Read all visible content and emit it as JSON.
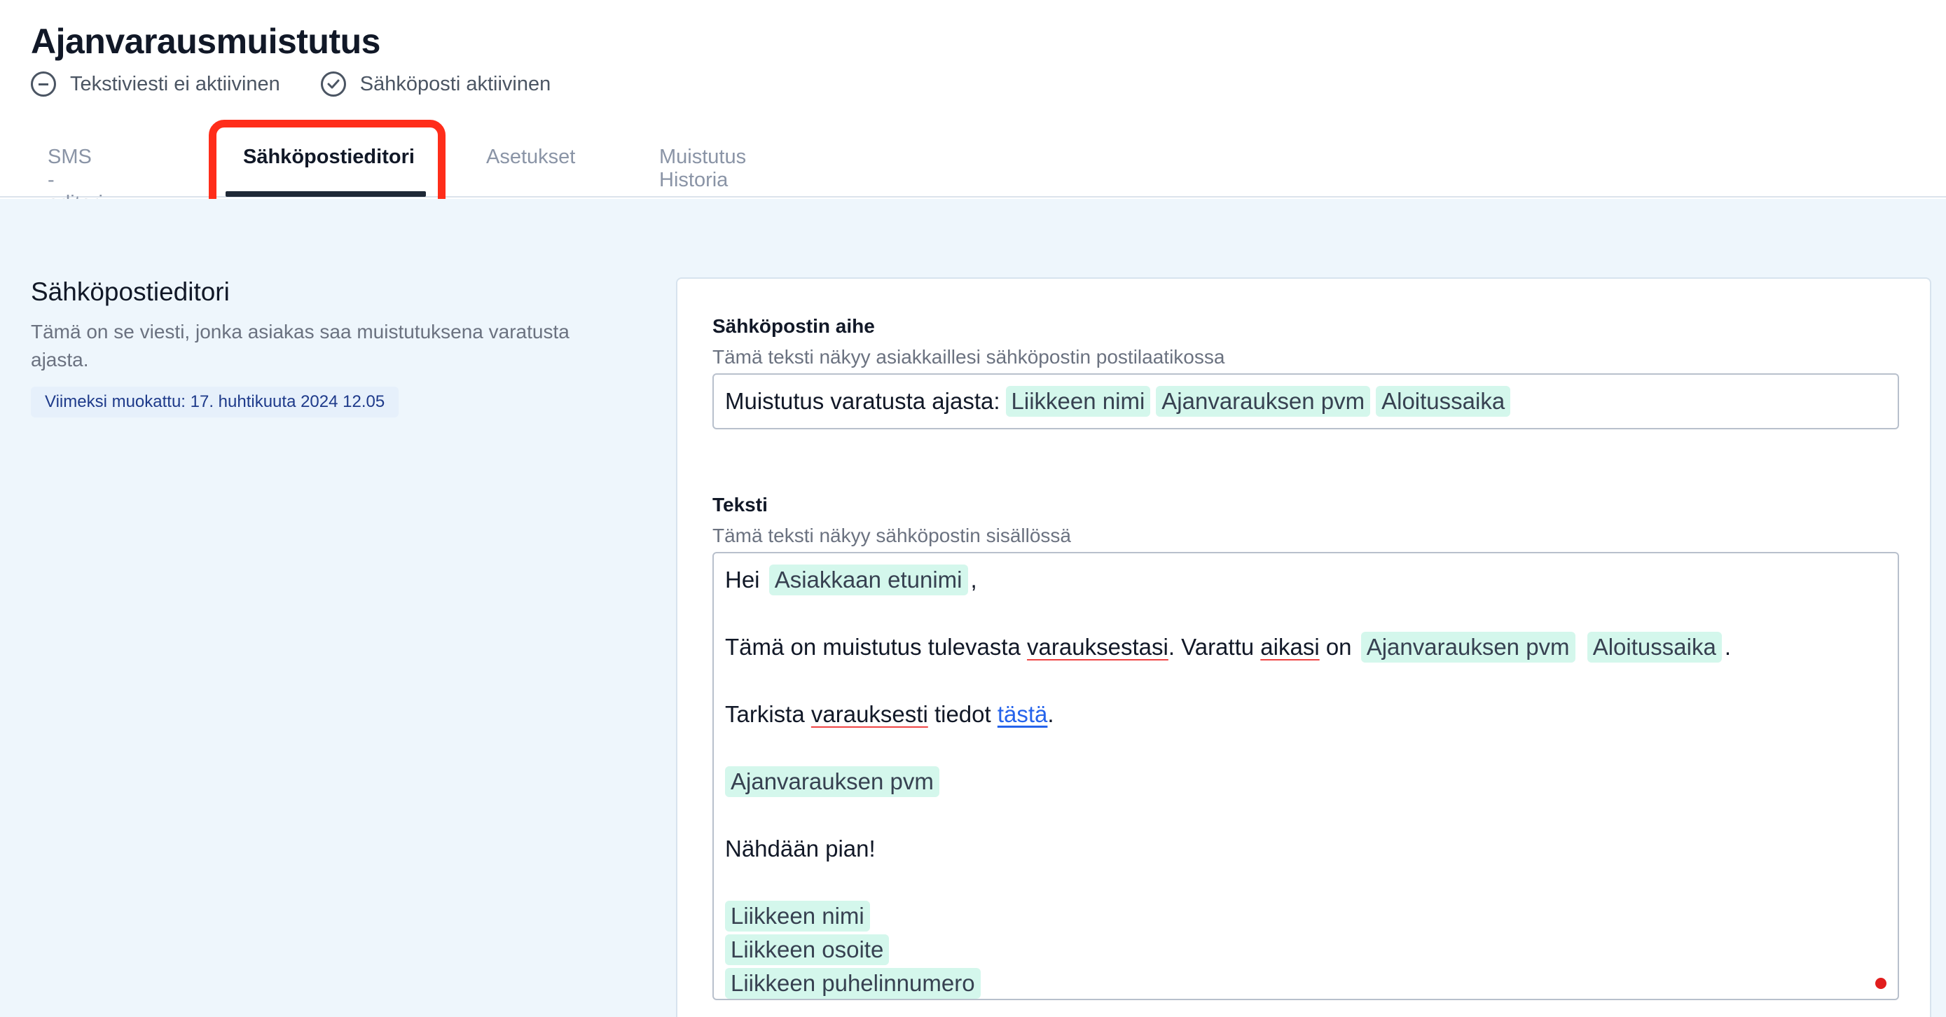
{
  "page": {
    "title": "Ajanvarausmuistutus",
    "statuses": [
      {
        "label": "Tekstiviesti ei aktiivinen",
        "icon": "minus-circle-icon"
      },
      {
        "label": "Sähköposti aktiivinen",
        "icon": "check-circle-icon"
      }
    ]
  },
  "tabs": [
    {
      "label": "SMS -editori",
      "active": false
    },
    {
      "label": "Sähköpostieditori",
      "active": true
    },
    {
      "label": "Asetukset",
      "active": false
    },
    {
      "label": "Muistutus Historia",
      "active": false
    }
  ],
  "left_panel": {
    "title": "Sähköpostieditori",
    "description": "Tämä on se viesti, jonka asiakas saa muistutuksena varatusta ajasta.",
    "last_modified": "Viimeksi muokattu: 17. huhtikuuta 2024 12.05"
  },
  "subject": {
    "label": "Sähköpostin aihe",
    "help": "Tämä teksti näkyy asiakkaillesi sähköpostin postilaatikossa",
    "prefix": "Muistutus varatusta ajasta:",
    "tags": [
      "Liikkeen nimi",
      "Ajanvarauksen pvm",
      "Aloitussaika"
    ]
  },
  "body": {
    "label": "Teksti",
    "help": "Tämä teksti näkyy sähköpostin sisällössä",
    "greeting_prefix": "Hei",
    "greeting_tag": "Asiakkaan etunimi",
    "greeting_suffix": ",",
    "line2_text1": "Tämä on muistutus tulevasta",
    "line2_word1": "varauksestasi",
    "line2_text2": ". Varattu",
    "line2_word2": "aikasi",
    "line2_text3": "on",
    "line2_tag1": "Ajanvarauksen pvm",
    "line2_tag2": "Aloitussaika",
    "line2_end": ".",
    "line3_text1": "Tarkista",
    "line3_word1": "varauksesti",
    "line3_text2": "tiedot",
    "line3_link": "tästä",
    "line3_end": ".",
    "date_tag": "Ajanvarauksen pvm",
    "closing": "Nähdään pian!",
    "signature_tags": [
      "Liikkeen nimi",
      "Liikkeen osoite",
      "Liikkeen puhelinnumero"
    ]
  },
  "colors": {
    "tag_bg": "#d4f7ec",
    "highlight": "#ff2d1a",
    "link": "#2563eb",
    "main_bg": "#eef6fc"
  }
}
